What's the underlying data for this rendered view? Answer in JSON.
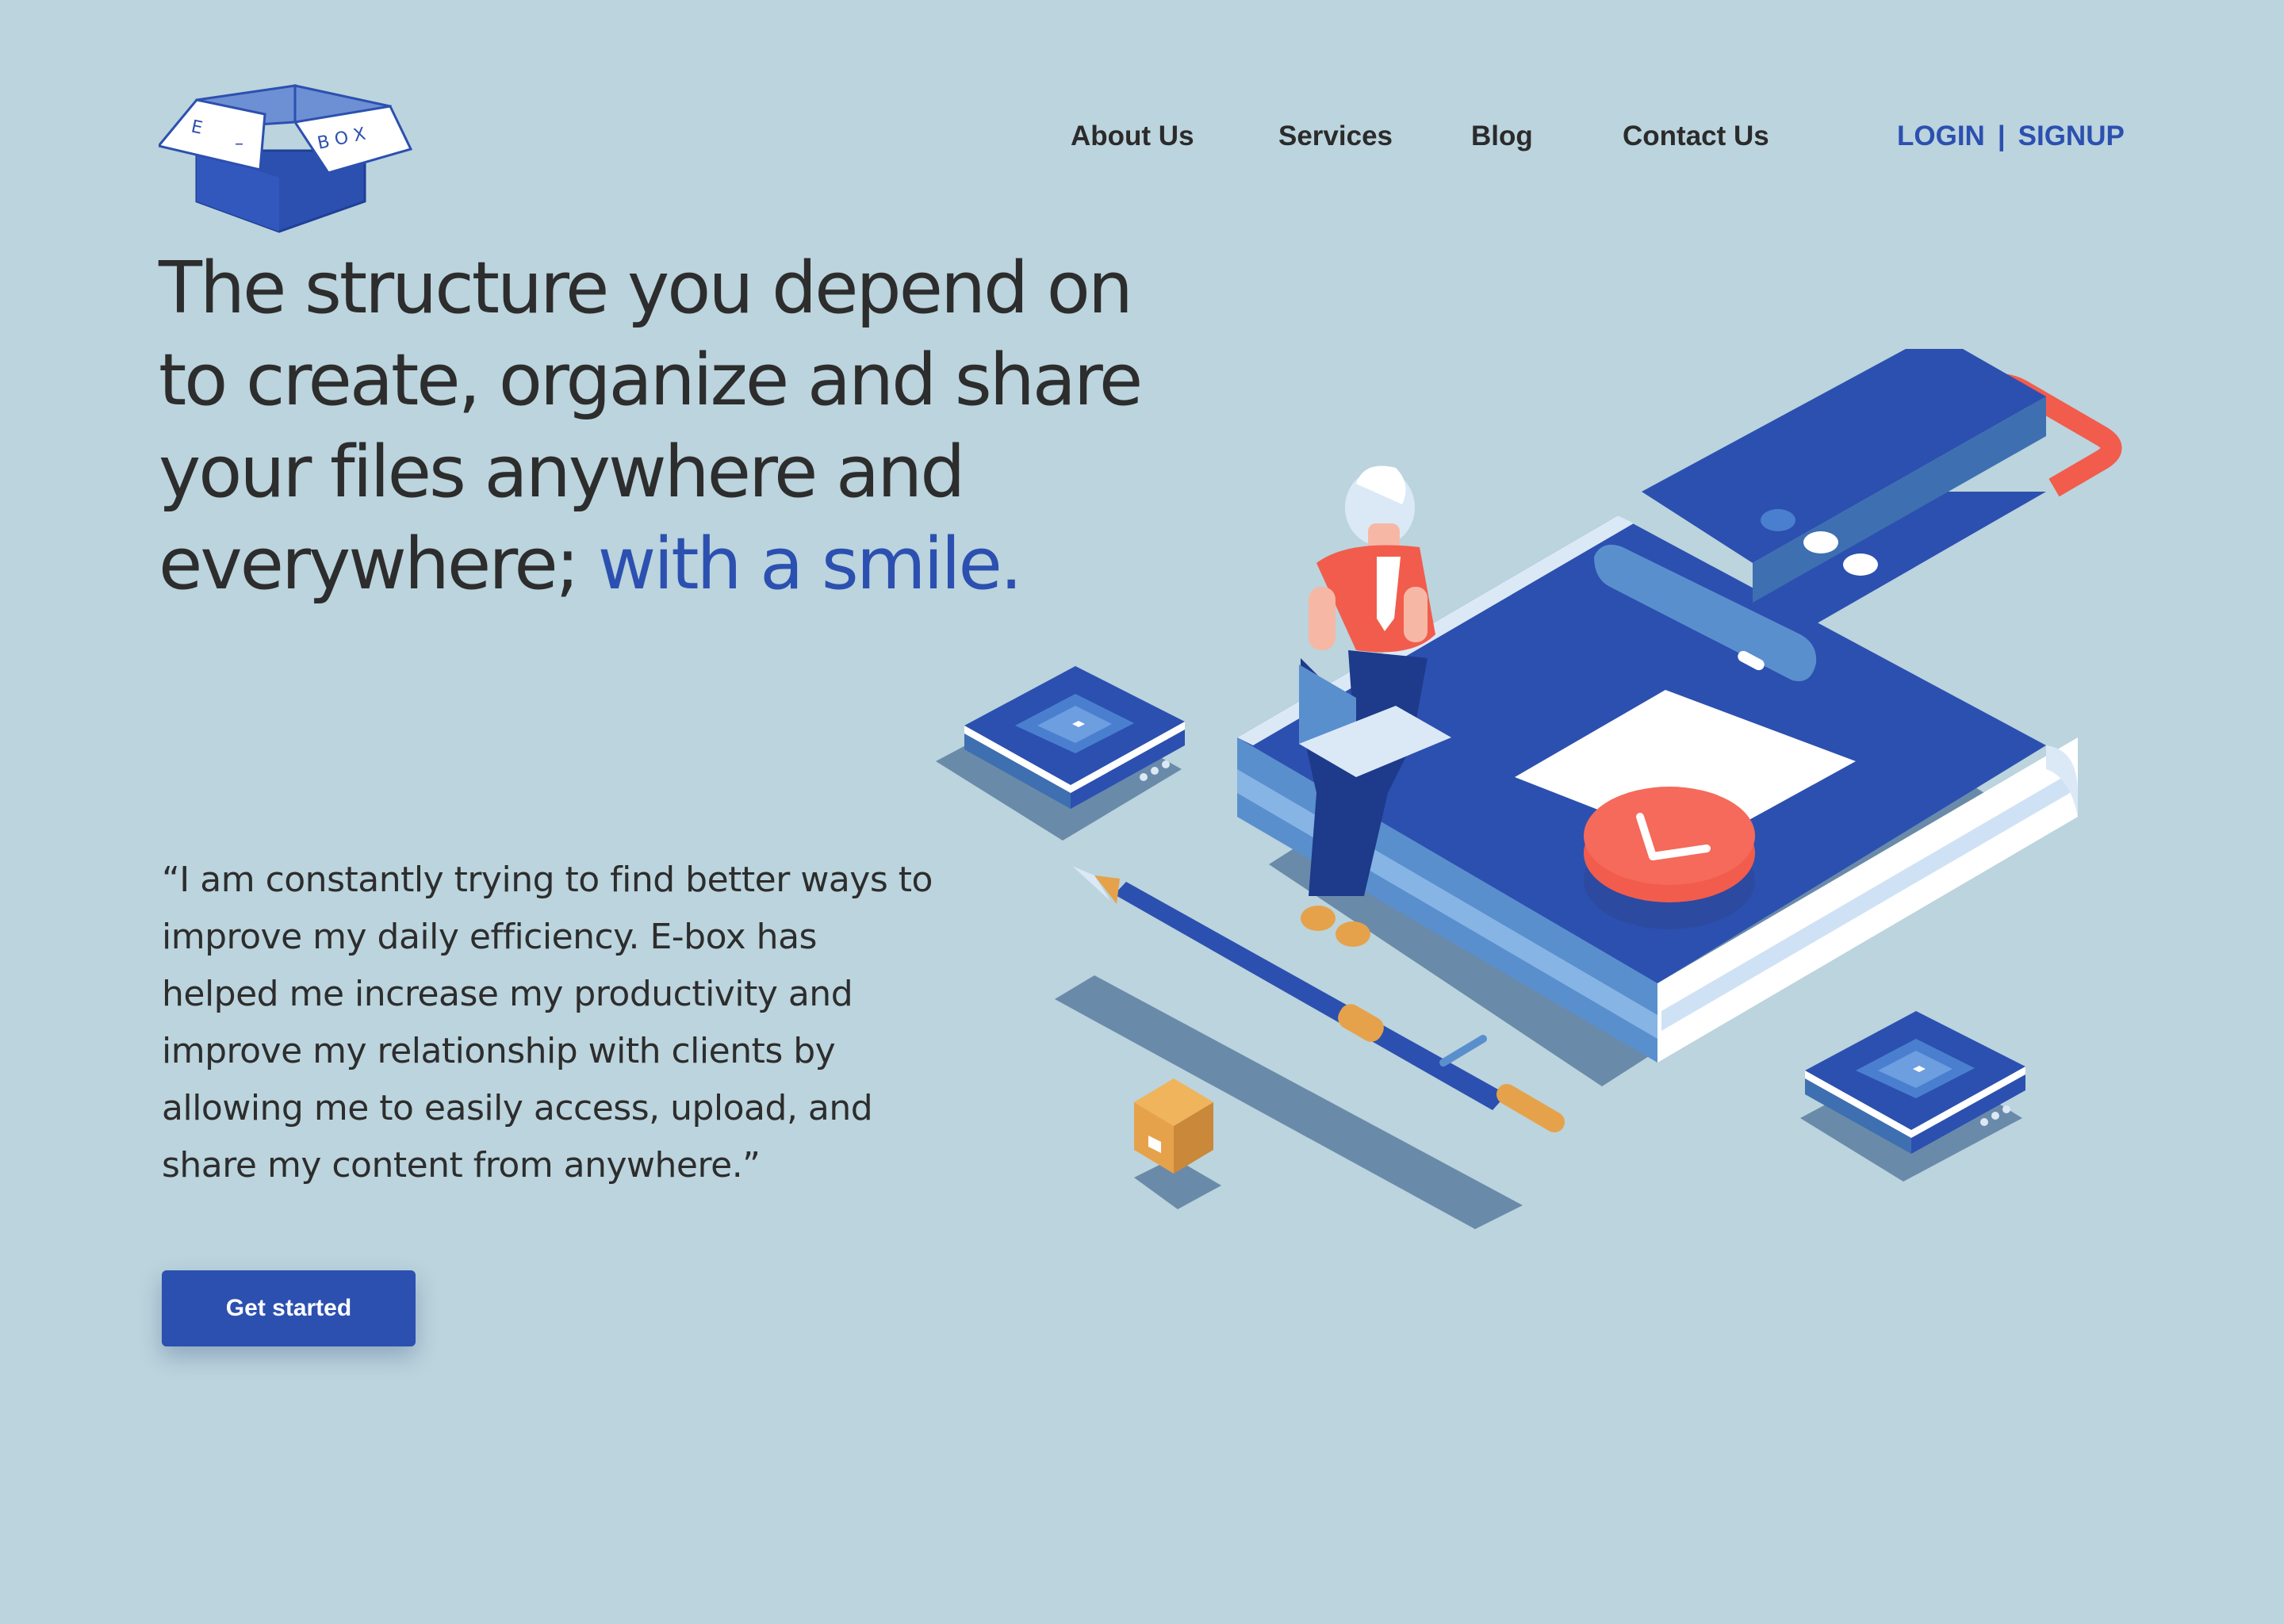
{
  "brand": {
    "name": "E-box"
  },
  "nav": {
    "items": [
      {
        "label": "About Us"
      },
      {
        "label": "Services"
      },
      {
        "label": "Blog"
      },
      {
        "label": "Contact Us"
      }
    ],
    "login_label": "LOGIN",
    "separator": "|",
    "signup_label": "SIGNUP"
  },
  "hero": {
    "headline_line1": "The structure you depend on",
    "headline_line2": "to create, organize and share",
    "headline_line3": "your files anywhere and",
    "headline_line4_prefix": "everywhere;",
    "headline_accent": "with a smile.",
    "quote_lines": [
      "“I am constantly trying to find better ways to",
      "improve my daily efficiency.  E-box has",
      "helped me increase my productivity and",
      "improve my relationship with clients by",
      "allowing me to easily access, upload, and",
      "share my content from anywhere.”"
    ],
    "cta_label": "Get started"
  },
  "colors": {
    "background": "#bbd4dd",
    "accent": "#2c50b0",
    "text": "#2d2d2d",
    "coral": "#f25c4c",
    "orange": "#e6a24a"
  },
  "icons": [
    "box-logo-icon",
    "isometric-illustration"
  ]
}
